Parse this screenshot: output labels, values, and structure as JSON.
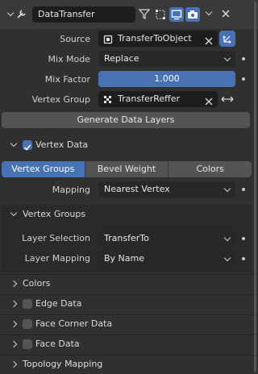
{
  "header": {
    "name": "DataTransfer",
    "icons": [
      "wrench-icon",
      "filter-icon",
      "editmode-icon",
      "viewport-icon",
      "camera-icon",
      "chevron-down-icon",
      "close-icon"
    ]
  },
  "source": {
    "label": "Source",
    "value": "TransferToObject"
  },
  "mix_mode": {
    "label": "Mix Mode",
    "value": "Replace"
  },
  "mix_factor": {
    "label": "Mix Factor",
    "value": "1.000"
  },
  "vertex_group": {
    "label": "Vertex Group",
    "value": "TransferReffer"
  },
  "generate_button": "Generate Data Layers",
  "vertex_data": {
    "title": "Vertex Data",
    "enabled": true,
    "tabs": [
      "Vertex Groups",
      "Bevel Weight",
      "Colors"
    ],
    "active_tab": "Vertex Groups",
    "mapping": {
      "label": "Mapping",
      "value": "Nearest Vertex"
    }
  },
  "vertex_groups": {
    "title": "Vertex Groups",
    "layer_selection": {
      "label": "Layer Selection",
      "value": "TransferTo"
    },
    "layer_mapping": {
      "label": "Layer Mapping",
      "value": "By Name"
    }
  },
  "panels": {
    "colors": "Colors",
    "edge_data": "Edge Data",
    "face_corner_data": "Face Corner Data",
    "face_data": "Face Data",
    "topology_mapping": "Topology Mapping"
  },
  "colors": {
    "accent": "#4772b3",
    "panel_bg": "#303030",
    "field_bg": "#1d1d1d"
  }
}
